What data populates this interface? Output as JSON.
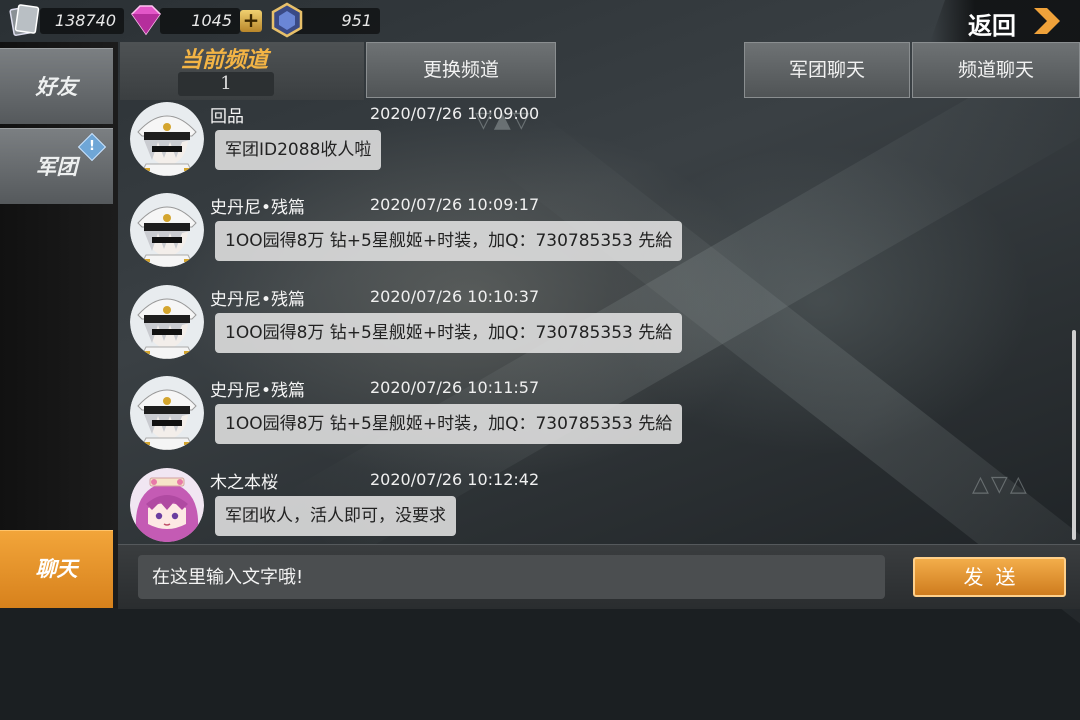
{
  "resources": {
    "cards": "138740",
    "diamonds": "1045",
    "medals": "951"
  },
  "back_label": "返回",
  "sidebar": {
    "items": [
      {
        "label": "好友"
      },
      {
        "label": "军团"
      },
      {
        "label": "聊天"
      }
    ]
  },
  "channel": {
    "current_title": "当前频道",
    "current_number": "1",
    "switch_label": "更换频道",
    "tabs": [
      {
        "label": "军团聊天"
      },
      {
        "label": "频道聊天"
      }
    ]
  },
  "messages": [
    {
      "name": "回品",
      "time": "2020/07/26 10:09:00",
      "text": "军团ID2088收人啦",
      "avatar": "officer"
    },
    {
      "name": "史丹尼•残篇",
      "time": "2020/07/26 10:09:17",
      "text": "1OO园得8万 钻+5星舰姬+时装，加Q：730785353 先給",
      "avatar": "officer"
    },
    {
      "name": "史丹尼•残篇",
      "time": "2020/07/26 10:10:37",
      "text": "1OO园得8万 钻+5星舰姬+时装，加Q：730785353 先給",
      "avatar": "officer"
    },
    {
      "name": "史丹尼•残篇",
      "time": "2020/07/26 10:11:57",
      "text": "1OO园得8万 钻+5星舰姬+时装，加Q：730785353 先給",
      "avatar": "officer"
    },
    {
      "name": "木之本桜",
      "time": "2020/07/26 10:12:42",
      "text": "军团收人，活人即可，没要求",
      "avatar": "pink-hair-girl"
    }
  ],
  "input": {
    "placeholder": "在这里输入文字哦!",
    "value": ""
  },
  "send_label": "发送",
  "colors": {
    "accent": "#f2a53a",
    "title_gold": "#f3b445",
    "bubble": "#e1e1e1"
  }
}
